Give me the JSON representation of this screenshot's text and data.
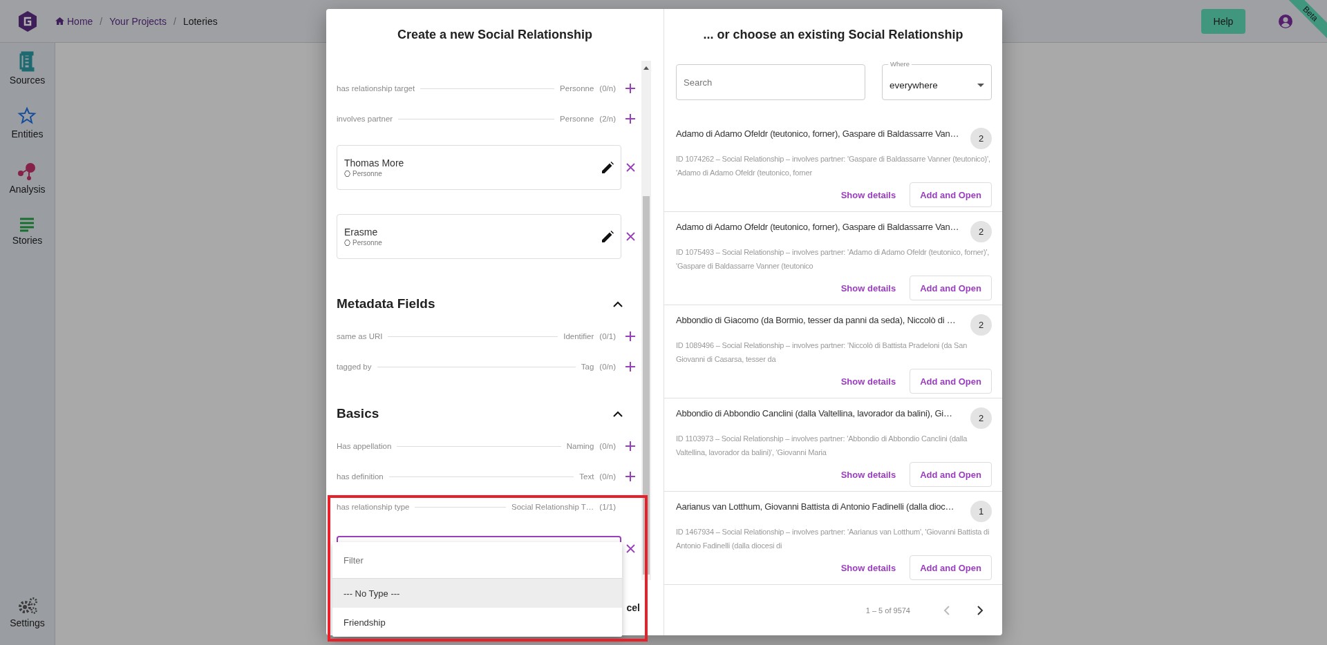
{
  "header": {
    "breadcrumb": [
      {
        "label": "Home",
        "kind": "home",
        "selected": false
      },
      {
        "label": "Your Projects",
        "kind": "link",
        "selected": false,
        "separator": "/"
      },
      {
        "label": "Loteries",
        "kind": "link",
        "selected": true,
        "separator": "/"
      }
    ],
    "help_button": "Help",
    "ribbon": "Beta"
  },
  "sidebar": {
    "items": [
      {
        "label": "Sources",
        "kind": "sources"
      },
      {
        "label": "Entities",
        "kind": "entities"
      },
      {
        "label": "Analysis",
        "kind": "analysis"
      },
      {
        "label": "Stories",
        "kind": "stories"
      }
    ],
    "settings": "Settings"
  },
  "dialog": {
    "create": {
      "title": "Create a new Social Relationship",
      "fields": [
        {
          "kind": "property",
          "label": "has relationship target",
          "range": "Personne",
          "count": "(0/n)",
          "can_add": true
        },
        {
          "kind": "property",
          "label": "involves partner",
          "range": "Personne",
          "count": "(2/n)",
          "can_add": true
        },
        {
          "kind": "entity",
          "name": "Thomas More",
          "type": "Personne"
        },
        {
          "kind": "entity",
          "name": "Erasme",
          "type": "Personne"
        },
        {
          "kind": "section",
          "title": "Metadata Fields",
          "expanded": true
        },
        {
          "kind": "property",
          "label": "same as URI",
          "range": "Identifier",
          "count": "(0/1)",
          "can_add": true
        },
        {
          "kind": "property",
          "label": "tagged by",
          "range": "Tag",
          "count": "(0/n)",
          "can_add": true
        },
        {
          "kind": "section",
          "title": "Basics",
          "expanded": true
        },
        {
          "kind": "property",
          "label": "Has appellation",
          "range": "Naming",
          "count": "(0/n)",
          "can_add": true
        },
        {
          "kind": "property",
          "label": "has definition",
          "range": "Text",
          "count": "(0/n)",
          "can_add": true
        },
        {
          "kind": "property",
          "label": "has relationship type",
          "range": "Social Relationship T…",
          "count": "(1/1)",
          "can_add": false
        },
        {
          "kind": "select",
          "dropdown": {
            "filter_placeholder": "Filter",
            "options": [
              {
                "label": "--- No Type ---",
                "selected": true
              },
              {
                "label": "Friendship",
                "selected": false
              }
            ]
          }
        }
      ],
      "cancel_button": "cel"
    },
    "choose": {
      "title": "... or choose an existing Social Relationship",
      "search": {
        "placeholder": "Search"
      },
      "where": {
        "label": "Where",
        "value": "everywhere"
      },
      "results": [
        {
          "title": "Adamo di Adamo Ofeldr (teutonico, forner), Gaspare di Baldassarre Van…",
          "count": "2",
          "description": "ID 1074262 – Social Relationship – involves partner: 'Gaspare di Baldassarre Vanner (teutonico)', 'Adamo di Adamo Ofeldr (teutonico, forner",
          "details_link": "Show details",
          "add_button": "Add and Open"
        },
        {
          "title": "Adamo di Adamo Ofeldr (teutonico, forner), Gaspare di Baldassarre Van…",
          "count": "2",
          "description": "ID 1075493 – Social Relationship – involves partner: 'Adamo di Adamo Ofeldr (teutonico, forner)', 'Gaspare di Baldassarre Vanner (teutonico",
          "details_link": "Show details",
          "add_button": "Add and Open"
        },
        {
          "title": "Abbondio di Giacomo (da Bormio, tesser da panni da seda), Niccolò di …",
          "count": "2",
          "description": "ID 1089496 – Social Relationship – involves partner: 'Niccolò di Battista Pradeloni (da San Giovanni di Casarsa, tesser da",
          "details_link": "Show details",
          "add_button": "Add and Open"
        },
        {
          "title": "Abbondio di Abbondio Canclini (dalla Valtellina, lavorador da balini), Gi…",
          "count": "2",
          "description": "ID 1103973 – Social Relationship – involves partner: 'Abbondio di Abbondio Canclini (dalla Valtellina, lavorador da balini)', 'Giovanni Maria",
          "details_link": "Show details",
          "add_button": "Add and Open"
        },
        {
          "title": "Aarianus van Lotthum, Giovanni Battista di Antonio Fadinelli (dalla dioc…",
          "count": "1",
          "description": "ID 1467934 – Social Relationship – involves partner: 'Aarianus van Lotthum', 'Giovanni Battista di Antonio Fadinelli (dalla diocesi di",
          "details_link": "Show details",
          "add_button": "Add and Open"
        }
      ],
      "pagination": {
        "range": "1 – 5 of 9574",
        "prev_disabled": true,
        "next_disabled": false
      }
    }
  }
}
